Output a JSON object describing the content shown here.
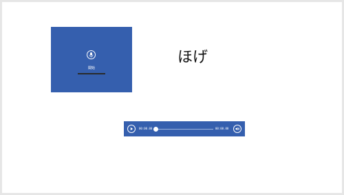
{
  "slide": {
    "heading": "ほげ"
  },
  "recorder": {
    "label": "開始",
    "icon": "microphone-icon",
    "accent_color": "#355fae"
  },
  "audio_player": {
    "current_time": "00:00.00",
    "total_time": "00:00.00",
    "progress": 0,
    "play_icon": "play-icon",
    "volume_icon": "volume-icon",
    "accent_color": "#355fae"
  }
}
